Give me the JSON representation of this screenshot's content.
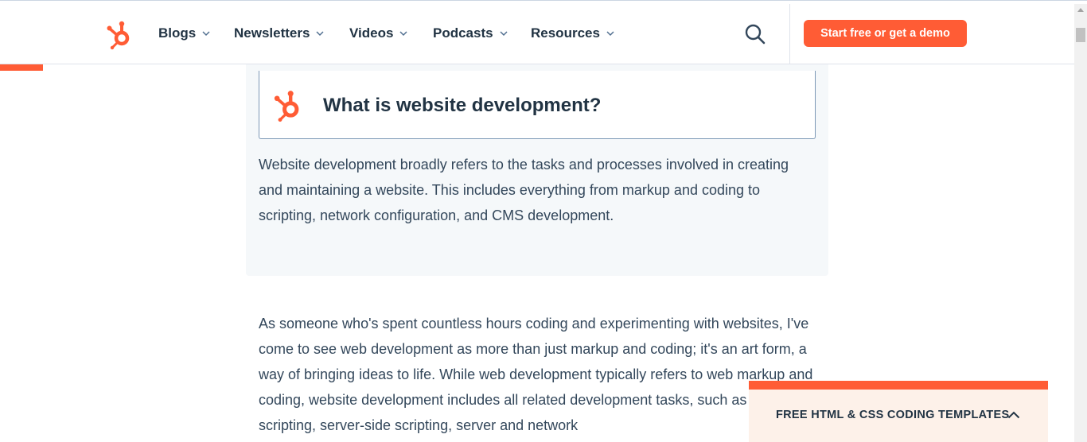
{
  "header": {
    "logo_icon": "hubspot-sprocket-icon",
    "nav": [
      {
        "label": "Blogs"
      },
      {
        "label": "Newsletters"
      },
      {
        "label": "Videos"
      },
      {
        "label": "Podcasts"
      },
      {
        "label": "Resources"
      }
    ],
    "search_icon": "search-icon",
    "cta_label": "Start free or get a demo"
  },
  "reading_progress": 0.04,
  "callout": {
    "icon": "hubspot-sprocket-icon",
    "title": "What is website development?",
    "text": "Website development broadly refers to the tasks and processes involved in creating and maintaining a website. This includes everything from markup and coding to scripting, network configuration, and CMS development."
  },
  "article": {
    "paragraph": "As someone who's spent countless hours coding and experimenting with websites, I've come to see web development as more than just markup and coding; it's an art form, a way of bringing ideas to life. While web development typically refers to web markup and coding, website development includes all related development tasks, such as client-side scripting, server-side scripting, server and network"
  },
  "sticky_offer": {
    "label": "FREE HTML & CSS CODING TEMPLATES",
    "toggle_icon": "chevron-up-icon"
  },
  "colors": {
    "brand": "#ff5c35",
    "text": "#33475b",
    "heading": "#213343",
    "callout_bg": "#f5f8fa",
    "sticky_bg": "#fdf1e9"
  }
}
